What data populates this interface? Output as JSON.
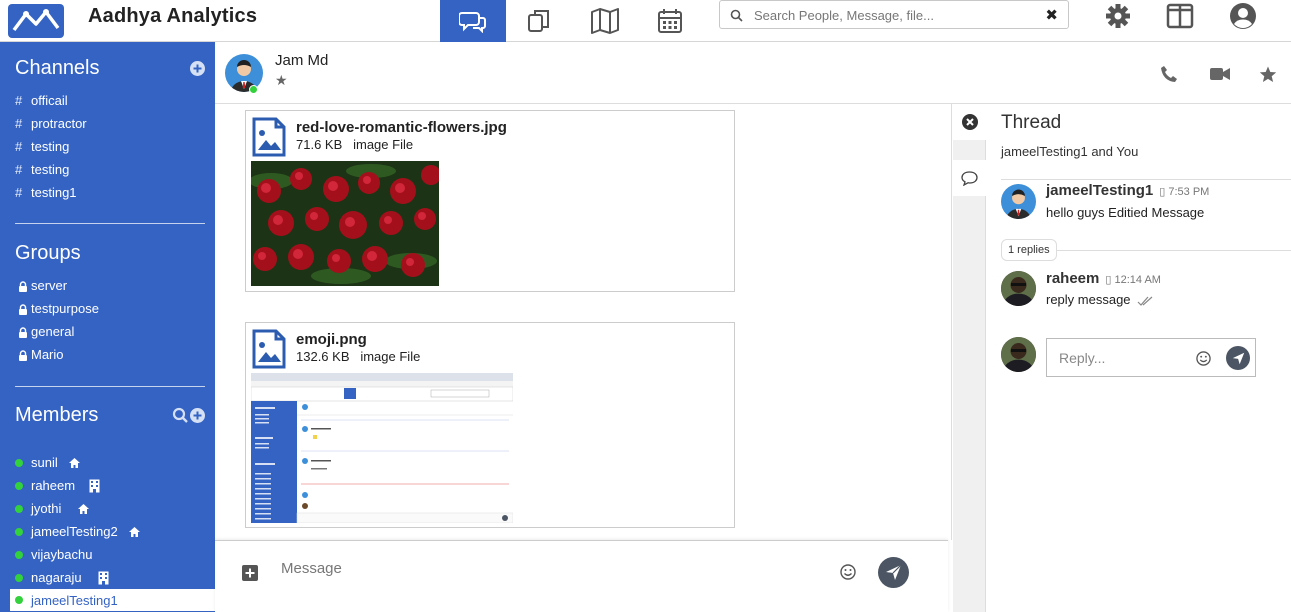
{
  "brand": {
    "name": "Aadhya Analytics"
  },
  "topnav": {
    "tabs": [
      {
        "icon": "chat-bubbles-icon",
        "active": true
      },
      {
        "icon": "copy-icon",
        "active": false
      },
      {
        "icon": "map-icon",
        "active": false
      },
      {
        "icon": "calendar-icon",
        "active": false
      }
    ],
    "search_placeholder": "Search People, Message, file...",
    "clear_label": "✖",
    "icons": [
      "gear-icon",
      "layout-icon",
      "account-icon"
    ]
  },
  "sidebar": {
    "channels_title": "Channels",
    "channels": [
      "officail",
      "protractor",
      "testing",
      "testing",
      "testing1"
    ],
    "groups_title": "Groups",
    "groups": [
      "server",
      "testpurpose",
      "general",
      "Mario"
    ],
    "members_title": "Members",
    "members": [
      {
        "name": "sunil",
        "icon": "home-icon"
      },
      {
        "name": "raheem",
        "icon": "building-icon"
      },
      {
        "name": "jyothi",
        "icon": "home-icon"
      },
      {
        "name": "jameelTesting2",
        "icon": "home-icon"
      },
      {
        "name": "vijaybachu",
        "icon": ""
      },
      {
        "name": "nagaraju",
        "icon": "building-icon"
      },
      {
        "name": "jameelTesting1",
        "icon": ""
      }
    ]
  },
  "header": {
    "name": "Jam Md",
    "star": "★"
  },
  "messages": [
    {
      "file_name": "red-love-romantic-flowers.jpg",
      "size": "71.6 KB",
      "type": "image File"
    },
    {
      "file_name": "emoji.png",
      "size": "132.6 KB",
      "type": "image File"
    }
  ],
  "composer": {
    "placeholder": "Message"
  },
  "thread": {
    "title": "Thread",
    "participants": "jameelTesting1 and You",
    "parent": {
      "user": "jameelTesting1",
      "time": "7:53 PM",
      "text": "hello guys Editied Message"
    },
    "replies_label": "1 replies",
    "reply": {
      "user": "raheem",
      "time": "12:14 AM",
      "text": "reply message"
    },
    "reply_placeholder": "Reply..."
  },
  "colors": {
    "sidebar": "#3463c4",
    "online": "#33d13c",
    "send": "#4b5563"
  }
}
